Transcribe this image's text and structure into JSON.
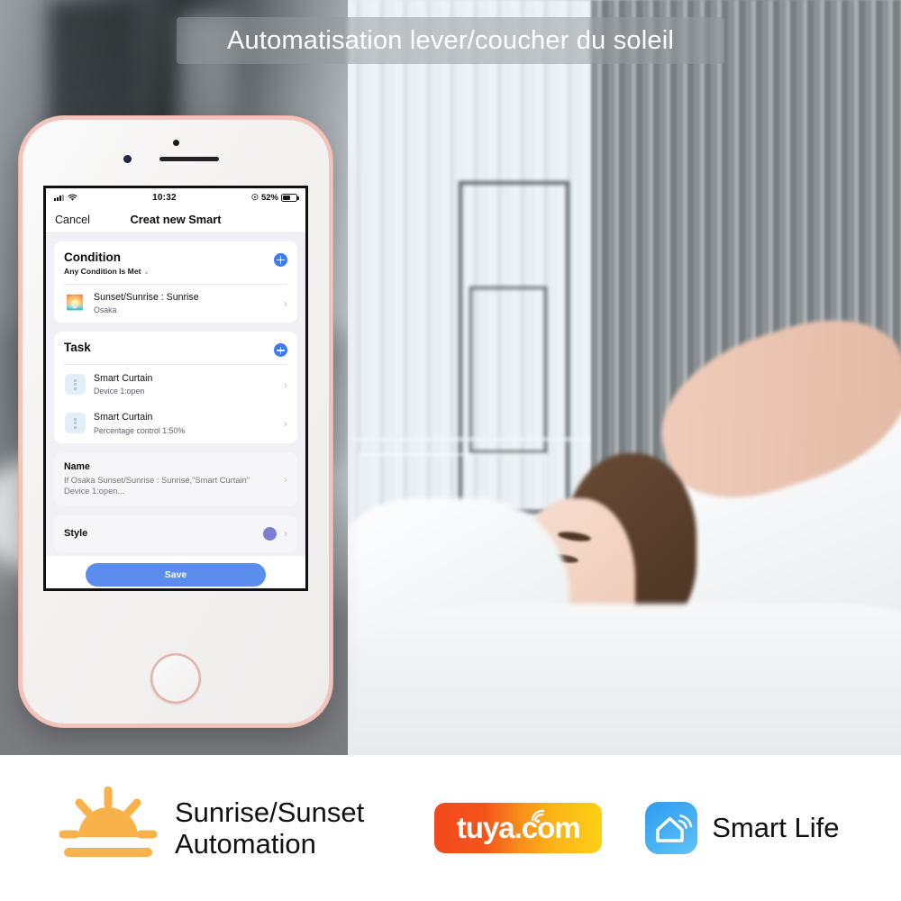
{
  "banner": {
    "title": "Automatisation lever/coucher du soleil"
  },
  "phone": {
    "status_bar": {
      "time": "10:32",
      "battery_percent": "52%",
      "signal_icon": "cellular-signal-icon",
      "wifi_icon": "wifi-icon",
      "lock_icon": "rotation-lock-icon",
      "battery_icon": "battery-icon"
    },
    "nav": {
      "cancel_label": "Cancel",
      "title": "Creat new Smart"
    },
    "condition_card": {
      "title": "Condition",
      "subtitle": "Any Condition Is Met",
      "caret": "⌄",
      "add_icon": "plus-icon",
      "rows": [
        {
          "icon": "sunrise-icon",
          "glyph": "🌅",
          "title": "Sunset/Sunrise : Sunrise",
          "subtitle": "Osaka",
          "chevron": "›"
        }
      ]
    },
    "task_card": {
      "title": "Task",
      "add_icon": "plus-icon",
      "rows": [
        {
          "icon": "smart-curtain-icon",
          "title": "Smart Curtain",
          "subtitle": "Device 1:open",
          "chevron": "›"
        },
        {
          "icon": "smart-curtain-icon",
          "title": "Smart Curtain",
          "subtitle": "Percentage control 1:50%",
          "chevron": "›"
        }
      ]
    },
    "name_card": {
      "title": "Name",
      "value": "If Osaka Sunset/Sunrise : Sunrise,\"Smart Curtain\" Device 1:open...",
      "chevron": "›"
    },
    "style_card": {
      "title": "Style",
      "color": "#7a7fd2",
      "chevron": "›"
    },
    "save_label": "Save"
  },
  "footer": {
    "feature_icon": "sunrise-sunset-icon",
    "feature_line1": "Sunrise/Sunset",
    "feature_line2": "Automation",
    "tuya_logo": {
      "text": "tuya",
      "suffix": ".com",
      "wifi_icon": "wifi-arc-icon"
    },
    "smart_life": {
      "icon": "smart-life-app-icon",
      "label": "Smart Life"
    }
  },
  "colors": {
    "accent_blue": "#3b7cf0",
    "save_blue": "#5b8def",
    "style_purple": "#7a7fd2",
    "sun_orange": "#f9b24a",
    "smartlife_blue": "#2e9bf0"
  }
}
